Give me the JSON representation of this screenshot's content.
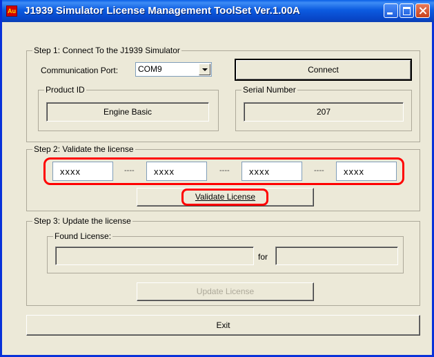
{
  "window": {
    "title": "J1939 Simulator License Management ToolSet Ver.1.00A",
    "icon_text": "Au"
  },
  "step1": {
    "legend": "Step 1: Connect To the J1939 Simulator",
    "port_label": "Communication Port:",
    "port_value": "COM9",
    "connect_label": "Connect",
    "product_id_legend": "Product ID",
    "product_id_value": "Engine Basic",
    "serial_legend": "Serial Number",
    "serial_value": "207"
  },
  "step2": {
    "legend": "Step 2: Validate the license",
    "keys": [
      "xxxx",
      "xxxx",
      "xxxx",
      "xxxx"
    ],
    "separator": "----",
    "validate_label": "Validate License"
  },
  "step3": {
    "legend": "Step 3: Update the license",
    "found_legend": "Found License:",
    "for_label": "for",
    "update_label": "Update License"
  },
  "exit_label": "Exit",
  "colors": {
    "titlebar": "#0a5fe6",
    "face": "#ece9d8",
    "highlight": "#ff0000"
  }
}
